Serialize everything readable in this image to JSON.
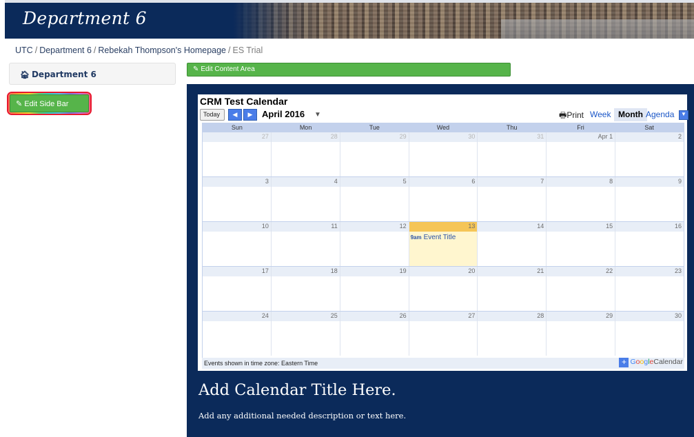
{
  "site": {
    "title": "Department 6"
  },
  "breadcrumb": {
    "items": [
      "UTC",
      "Department 6",
      "Rebekah Thompson's Homepage"
    ],
    "separator": "/",
    "current": "ES Trial"
  },
  "sidebar": {
    "title": "Department 6",
    "home_icon": "home-icon",
    "edit_button": "Edit Side Bar"
  },
  "content": {
    "edit_button": "Edit Content Area",
    "calendar_heading": "Add Calendar Title Here.",
    "calendar_description": "Add any additional needed description or text here."
  },
  "calendar": {
    "name": "CRM Test Calendar",
    "today_label": "Today",
    "prev_icon": "chevron-left-icon",
    "next_icon": "chevron-right-icon",
    "month_label": "April 2016",
    "print_label": "Print",
    "views": [
      "Week",
      "Month",
      "Agenda"
    ],
    "active_view": "Month",
    "days_of_week": [
      "Sun",
      "Mon",
      "Tue",
      "Wed",
      "Thu",
      "Fri",
      "Sat"
    ],
    "weeks": [
      [
        {
          "d": "27",
          "o": true
        },
        {
          "d": "28",
          "o": true
        },
        {
          "d": "29",
          "o": true
        },
        {
          "d": "30",
          "o": true
        },
        {
          "d": "31",
          "o": true
        },
        {
          "d": "Apr 1"
        },
        {
          "d": "2"
        }
      ],
      [
        {
          "d": "3"
        },
        {
          "d": "4"
        },
        {
          "d": "5"
        },
        {
          "d": "6"
        },
        {
          "d": "7"
        },
        {
          "d": "8"
        },
        {
          "d": "9"
        }
      ],
      [
        {
          "d": "10"
        },
        {
          "d": "11"
        },
        {
          "d": "12"
        },
        {
          "d": "13",
          "today": true,
          "event": {
            "time": "9am",
            "title": "Event Title"
          }
        },
        {
          "d": "14"
        },
        {
          "d": "15"
        },
        {
          "d": "16"
        }
      ],
      [
        {
          "d": "17"
        },
        {
          "d": "18"
        },
        {
          "d": "19"
        },
        {
          "d": "20"
        },
        {
          "d": "21"
        },
        {
          "d": "22"
        },
        {
          "d": "23"
        }
      ],
      [
        {
          "d": "24"
        },
        {
          "d": "25"
        },
        {
          "d": "26"
        },
        {
          "d": "27"
        },
        {
          "d": "28"
        },
        {
          "d": "29"
        },
        {
          "d": "30"
        }
      ]
    ],
    "timezone_note": "Events shown in time zone: Eastern Time",
    "badge": {
      "google": "Google",
      "calendar": "Calendar"
    },
    "colors": {
      "today_header": "#f5c557",
      "today_bg": "#fff6cf",
      "grid": "#c3d1ec"
    }
  },
  "colors": {
    "brand_navy": "#0b2a5a",
    "edit_green": "#56b44a",
    "highlight_red": "#e7192e"
  }
}
